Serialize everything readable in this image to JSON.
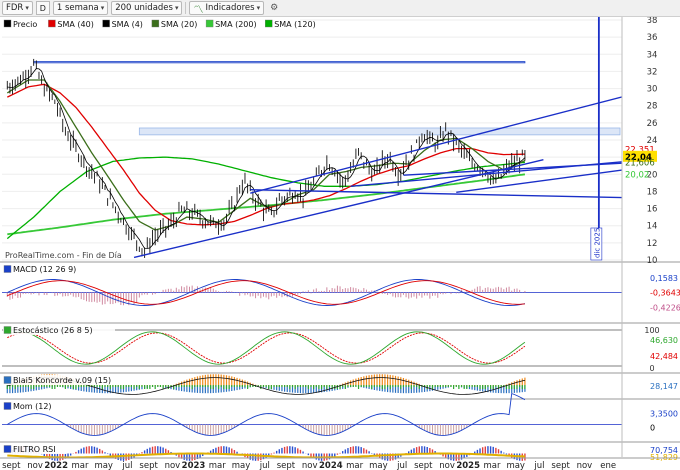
{
  "toolbar": {
    "symbol": "FDR",
    "mode_letter": "D",
    "timeframe": "1 semana",
    "units": "200 unidades",
    "indicators": "Indicadores"
  },
  "legend": [
    {
      "label": "Precio",
      "color": "#000000"
    },
    {
      "label": "SMA (40)",
      "color": "#e00000"
    },
    {
      "label": "SMA (4)",
      "color": "#000000"
    },
    {
      "label": "SMA (20)",
      "color": "#3b6e1b"
    },
    {
      "label": "SMA (200)",
      "color": "#37c837"
    },
    {
      "label": "SMA (120)",
      "color": "#00b000"
    }
  ],
  "source_note": "ProRealTime.com - Fin de Día",
  "vertical_note": "dic 2025",
  "price_axis": {
    "ticks": [
      38,
      36,
      34,
      32,
      30,
      28,
      26,
      24,
      22,
      20,
      18,
      16,
      14,
      12,
      10
    ]
  },
  "price_badges": [
    {
      "text": "22,351",
      "color": "#e00000",
      "value": 22.9
    },
    {
      "text": "22,04",
      "color": "#000000",
      "value": 22.04,
      "bg": "#ffe000"
    },
    {
      "text": "21,606",
      "color": "#3b6e1b",
      "value": 21.4
    },
    {
      "text": "20,02",
      "color": "#37c837",
      "value": 20.0
    }
  ],
  "panels": [
    {
      "title": "MACD (12 26 9)",
      "values": [
        "0,1583",
        "-0,3643",
        "-0,4226"
      ],
      "colors": [
        "#1a40c8",
        "#e00000",
        "#c0508a"
      ]
    },
    {
      "title": "Estocástico (26 8 5)",
      "values": [
        "46,630",
        "42,484"
      ],
      "ticks": [
        "100",
        "0"
      ],
      "colors": [
        "#2ea82e",
        "#e00000"
      ]
    },
    {
      "title": "Blai5 Koncorde v.09 (15)",
      "values": [
        "28,147"
      ],
      "colors": [
        "#2a70c0"
      ]
    },
    {
      "title": "Mom (12)",
      "values": [
        "3,3500",
        "0"
      ],
      "colors": [
        "#1a40c8",
        "#000000"
      ]
    },
    {
      "title": "FILTRO RSI",
      "values": [
        "70,754",
        "51,829"
      ],
      "colors": [
        "#1a40c8",
        "#e0b000"
      ]
    }
  ],
  "time_axis": {
    "labels": [
      {
        "text": "sept",
        "bold": false,
        "week": 0
      },
      {
        "text": "nov",
        "bold": false,
        "week": 9
      },
      {
        "text": "2022",
        "bold": true,
        "week": 17
      },
      {
        "text": "mar",
        "bold": false,
        "week": 26
      },
      {
        "text": "may",
        "bold": false,
        "week": 35
      },
      {
        "text": "jul",
        "bold": false,
        "week": 44
      },
      {
        "text": "sept",
        "bold": false,
        "week": 52
      },
      {
        "text": "nov",
        "bold": false,
        "week": 61
      },
      {
        "text": "2023",
        "bold": true,
        "week": 69
      },
      {
        "text": "mar",
        "bold": false,
        "week": 78
      },
      {
        "text": "may",
        "bold": false,
        "week": 87
      },
      {
        "text": "jul",
        "bold": false,
        "week": 96
      },
      {
        "text": "sept",
        "bold": false,
        "week": 104
      },
      {
        "text": "nov",
        "bold": false,
        "week": 113
      },
      {
        "text": "2024",
        "bold": true,
        "week": 121
      },
      {
        "text": "mar",
        "bold": false,
        "week": 130
      },
      {
        "text": "may",
        "bold": false,
        "week": 139
      },
      {
        "text": "jul",
        "bold": false,
        "week": 148
      },
      {
        "text": "sept",
        "bold": false,
        "week": 156
      },
      {
        "text": "nov",
        "bold": false,
        "week": 165
      },
      {
        "text": "2025",
        "bold": true,
        "week": 173
      },
      {
        "text": "mar",
        "bold": false,
        "week": 182
      },
      {
        "text": "may",
        "bold": false,
        "week": 191
      },
      {
        "text": "jul",
        "bold": false,
        "week": 200
      },
      {
        "text": "sept",
        "bold": false,
        "week": 208
      },
      {
        "text": "nov",
        "bold": false,
        "week": 217
      },
      {
        "text": "ene",
        "bold": false,
        "week": 226
      }
    ]
  },
  "chart_data": {
    "type": "line",
    "ylim": [
      10,
      38
    ],
    "xlim_weeks": [
      -2,
      232
    ],
    "price_anchors": [
      [
        0,
        30.2
      ],
      [
        6,
        31.3
      ],
      [
        10,
        32.8
      ],
      [
        14,
        30.0
      ],
      [
        18,
        28.5
      ],
      [
        22,
        25.0
      ],
      [
        26,
        23.0
      ],
      [
        30,
        21.0
      ],
      [
        34,
        19.5
      ],
      [
        38,
        17.5
      ],
      [
        42,
        15.5
      ],
      [
        46,
        13.5
      ],
      [
        49,
        12.2
      ],
      [
        52,
        11.0
      ],
      [
        55,
        12.5
      ],
      [
        58,
        13.3
      ],
      [
        62,
        14.2
      ],
      [
        66,
        15.8
      ],
      [
        70,
        15.5
      ],
      [
        74,
        14.8
      ],
      [
        78,
        14.2
      ],
      [
        82,
        14.5
      ],
      [
        86,
        16.5
      ],
      [
        88,
        18.5
      ],
      [
        90,
        19.0
      ],
      [
        93,
        17.5
      ],
      [
        97,
        16.0
      ],
      [
        100,
        15.2
      ],
      [
        103,
        17.0
      ],
      [
        106,
        17.4
      ],
      [
        109,
        18.0
      ],
      [
        112,
        17.4
      ],
      [
        115,
        18.6
      ],
      [
        118,
        20.0
      ],
      [
        121,
        21.5
      ],
      [
        124,
        20.5
      ],
      [
        127,
        19.0
      ],
      [
        130,
        20.5
      ],
      [
        133,
        22.5
      ],
      [
        136,
        21.0
      ],
      [
        139,
        20.0
      ],
      [
        142,
        21.5
      ],
      [
        145,
        22.0
      ],
      [
        148,
        20.0
      ],
      [
        151,
        21.5
      ],
      [
        154,
        22.5
      ],
      [
        157,
        24.8
      ],
      [
        160,
        24.0
      ],
      [
        163,
        23.5
      ],
      [
        166,
        25.2
      ],
      [
        169,
        24.0
      ],
      [
        172,
        22.8
      ],
      [
        175,
        21.5
      ],
      [
        178,
        21.0
      ],
      [
        181,
        20.5
      ],
      [
        184,
        19.0
      ],
      [
        187,
        19.8
      ],
      [
        190,
        21.0
      ],
      [
        193,
        21.5
      ],
      [
        196,
        22.04
      ]
    ],
    "sma40_anchors": [
      [
        0,
        29.0
      ],
      [
        8,
        30.2
      ],
      [
        14,
        30.5
      ],
      [
        20,
        29.5
      ],
      [
        26,
        27.8
      ],
      [
        32,
        25.5
      ],
      [
        38,
        23.0
      ],
      [
        44,
        20.5
      ],
      [
        50,
        17.8
      ],
      [
        56,
        15.8
      ],
      [
        62,
        14.6
      ],
      [
        68,
        14.2
      ],
      [
        74,
        14.1
      ],
      [
        80,
        14.2
      ],
      [
        86,
        14.5
      ],
      [
        92,
        15.2
      ],
      [
        98,
        16.0
      ],
      [
        104,
        16.5
      ],
      [
        110,
        16.7
      ],
      [
        116,
        17.0
      ],
      [
        122,
        17.5
      ],
      [
        128,
        18.3
      ],
      [
        134,
        19.2
      ],
      [
        140,
        20.0
      ],
      [
        146,
        20.6
      ],
      [
        152,
        21.0
      ],
      [
        158,
        21.8
      ],
      [
        164,
        22.5
      ],
      [
        170,
        23.0
      ],
      [
        176,
        23.0
      ],
      [
        182,
        22.5
      ],
      [
        188,
        22.3
      ],
      [
        196,
        22.35
      ]
    ],
    "sma20_anchors": [
      [
        0,
        29.5
      ],
      [
        8,
        31.0
      ],
      [
        14,
        31.0
      ],
      [
        20,
        28.5
      ],
      [
        26,
        25.5
      ],
      [
        32,
        22.5
      ],
      [
        38,
        19.8
      ],
      [
        44,
        17.0
      ],
      [
        50,
        14.5
      ],
      [
        56,
        13.5
      ],
      [
        62,
        14.0
      ],
      [
        68,
        15.0
      ],
      [
        74,
        14.8
      ],
      [
        80,
        14.4
      ],
      [
        86,
        15.8
      ],
      [
        92,
        17.2
      ],
      [
        98,
        16.2
      ],
      [
        104,
        16.5
      ],
      [
        110,
        17.6
      ],
      [
        116,
        18.2
      ],
      [
        122,
        20.0
      ],
      [
        128,
        20.3
      ],
      [
        134,
        20.8
      ],
      [
        140,
        21.0
      ],
      [
        146,
        21.3
      ],
      [
        152,
        21.2
      ],
      [
        158,
        22.8
      ],
      [
        164,
        24.0
      ],
      [
        170,
        24.2
      ],
      [
        176,
        23.0
      ],
      [
        182,
        21.5
      ],
      [
        188,
        20.5
      ],
      [
        196,
        21.6
      ]
    ],
    "sma120_anchors": [
      [
        0,
        12.5
      ],
      [
        10,
        15.0
      ],
      [
        20,
        18.0
      ],
      [
        30,
        20.3
      ],
      [
        40,
        21.5
      ],
      [
        50,
        21.9
      ],
      [
        60,
        22.0
      ],
      [
        70,
        21.8
      ],
      [
        80,
        21.2
      ],
      [
        90,
        20.4
      ],
      [
        100,
        19.6
      ],
      [
        110,
        19.0
      ],
      [
        120,
        18.6
      ],
      [
        130,
        18.6
      ],
      [
        140,
        18.8
      ],
      [
        150,
        19.2
      ],
      [
        160,
        19.8
      ],
      [
        170,
        20.4
      ],
      [
        180,
        20.9
      ],
      [
        190,
        21.2
      ],
      [
        196,
        21.4
      ]
    ],
    "sma200_anchors": [
      [
        0,
        13.0
      ],
      [
        20,
        13.8
      ],
      [
        40,
        14.7
      ],
      [
        60,
        15.4
      ],
      [
        80,
        15.9
      ],
      [
        100,
        16.4
      ],
      [
        120,
        17.0
      ],
      [
        140,
        17.7
      ],
      [
        160,
        18.5
      ],
      [
        180,
        19.3
      ],
      [
        196,
        20.0
      ]
    ],
    "zones": [
      {
        "x0": 10,
        "x1": 196,
        "y0": 33.0,
        "y1": 33.15,
        "color": "#1a40c8"
      },
      {
        "x0": 50,
        "x1": 232,
        "y0": 24.6,
        "y1": 25.4,
        "color": "#9ab8e8"
      }
    ],
    "trendlines": [
      {
        "x0": 48,
        "y0": 10.3,
        "x1": 203,
        "y1": 21.7
      },
      {
        "x0": 92,
        "y0": 17.8,
        "x1": 245,
        "y1": 30.0
      },
      {
        "x0": 92,
        "y0": 18.2,
        "x1": 245,
        "y1": 17.2
      },
      {
        "x0": 130,
        "y0": 18.6,
        "x1": 245,
        "y1": 21.8
      },
      {
        "x0": 150,
        "y0": 19.9,
        "x1": 245,
        "y1": 21.5
      },
      {
        "x0": 170,
        "y0": 17.9,
        "x1": 245,
        "y1": 21.0
      }
    ],
    "vertical_line_week": 224,
    "last_week": 196
  }
}
